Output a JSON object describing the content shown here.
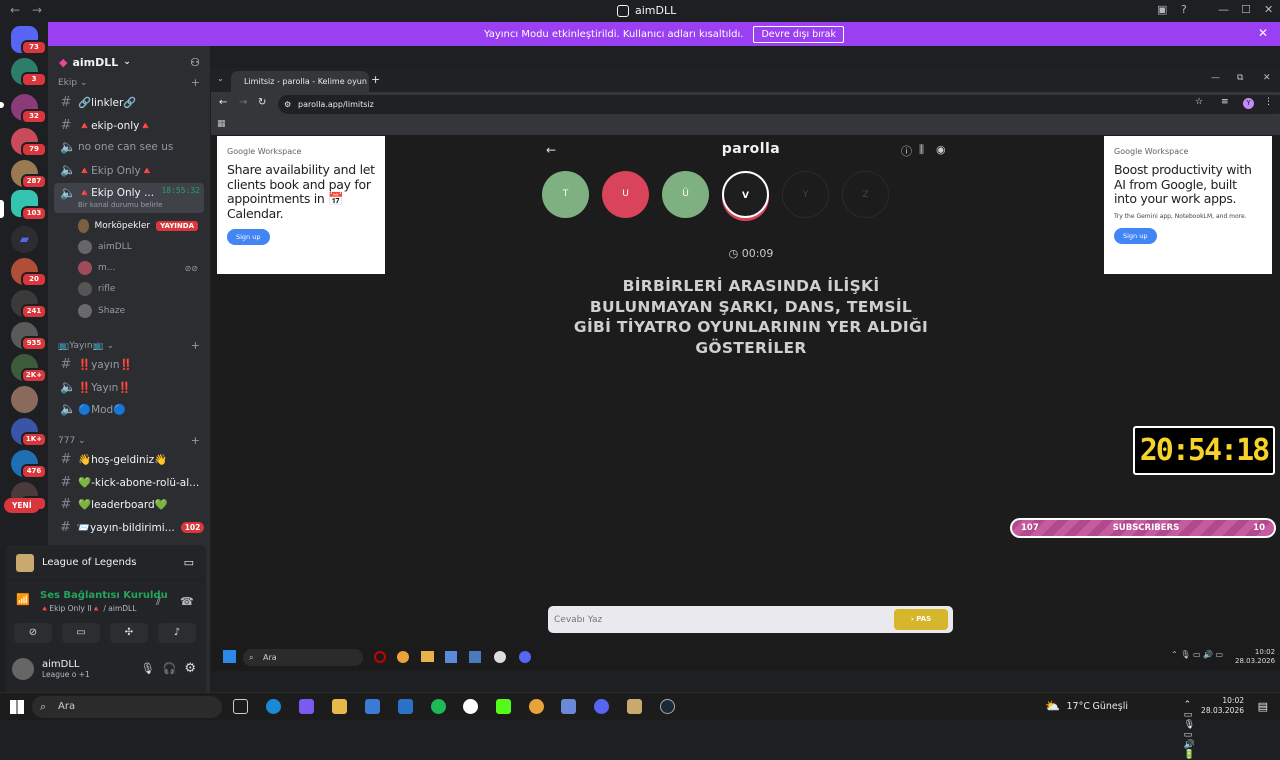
{
  "window": {
    "title": "aimDLL"
  },
  "banner": {
    "text": "Yayıncı Modu etkinleştirildi. Kullanıcı adları kısaltıldı.",
    "button": "Devre dışı bırak"
  },
  "servers": {
    "badges": [
      "73",
      "3",
      "32",
      "79",
      "287",
      "103",
      "20",
      "241",
      "935",
      "2K+",
      "1K+",
      "476",
      "7"
    ],
    "new_label": "YENİ"
  },
  "sidebar": {
    "server_name": "aimDLL",
    "categories": [
      "Ekip",
      "Yayın",
      "777"
    ],
    "channels": [
      {
        "name": "🔗linkler🔗"
      },
      {
        "name": "🔺ekip-only🔺"
      },
      {
        "name": "no one can see us"
      },
      {
        "name": "🔺Ekip Only🔺"
      },
      {
        "name": "🔺Ekip Only ...",
        "time": "18:55:32",
        "status": "Bir kanal durumu belirle"
      },
      {
        "name": "‼️yayın‼️"
      },
      {
        "name": "‼️Yayın‼️"
      },
      {
        "name": "🔵Mod🔵"
      },
      {
        "name": "👋hoş-geldiniz👋"
      },
      {
        "name": "💚-kick-abone-rolü-al..."
      },
      {
        "name": "💚leaderboard💚"
      },
      {
        "name": "📨yayın-bildirimi...",
        "count": "102"
      }
    ],
    "voice_users": [
      {
        "name": "Morköpekler",
        "live": "YAYINDA"
      },
      {
        "name": "aimDLL"
      },
      {
        "name": "m..."
      },
      {
        "name": "rifle"
      },
      {
        "name": "Shaze"
      }
    ]
  },
  "activity": {
    "game": "League of Legends"
  },
  "voice": {
    "status": "Ses Bağlantısı Kuruldu",
    "channel": "🔺Ekip Only II🔺 / aimDLL"
  },
  "user": {
    "name": "aimDLL",
    "status": "League o +1"
  },
  "browser": {
    "tab_title": "Limitsiz - parolla - Kelime oyun",
    "url": "parolla.app/limitsiz",
    "profile_initial": "Y"
  },
  "ads": {
    "left": {
      "brand": "Google Workspace",
      "headline": "Share availability and let clients book and pay for appointments in 📅Calendar.",
      "cta": "Sign up"
    },
    "right": {
      "brand": "Google Workspace",
      "headline": "Boost productivity with AI from Google, built into your work apps.",
      "sub": "Try the Gemini app, NotebookLM, and more.",
      "cta": "Sign up"
    }
  },
  "game": {
    "logo": "parolla",
    "letters": [
      {
        "char": "T",
        "state": "correct",
        "color": "#7fb082"
      },
      {
        "char": "U",
        "state": "wrong",
        "color": "#d9445a"
      },
      {
        "char": "Ü",
        "state": "correct",
        "color": "#7fb082"
      },
      {
        "char": "V",
        "state": "current",
        "color": "#1e1e1e"
      },
      {
        "char": "Y",
        "state": "pending",
        "color": "#1c1c1c"
      },
      {
        "char": "Z",
        "state": "pending",
        "color": "#1c1c1c"
      }
    ],
    "timer": "00:09",
    "question": "BİRBİRLERİ ARASINDA İLİŞKİ BULUNMAYAN ŞARKI, DANS, TEMSİL GİBİ TİYATRO OYUNLARININ YER ALDIĞI GÖSTERİLER",
    "answer_placeholder": "Cevabı Yaz",
    "pass_button": "PAS"
  },
  "overlay": {
    "clock": "20:54:18",
    "subs_current": "107",
    "subs_label": "SUBSCRIBERS",
    "subs_goal": "10"
  },
  "inner_taskbar": {
    "search": "Ara",
    "clock_time": "10:02",
    "clock_date": "28.03.2026"
  },
  "taskbar": {
    "search": "Ara",
    "weather_temp": "17°C",
    "weather_text": "Güneşli",
    "time": "10:02",
    "date": "28.03.2026"
  }
}
